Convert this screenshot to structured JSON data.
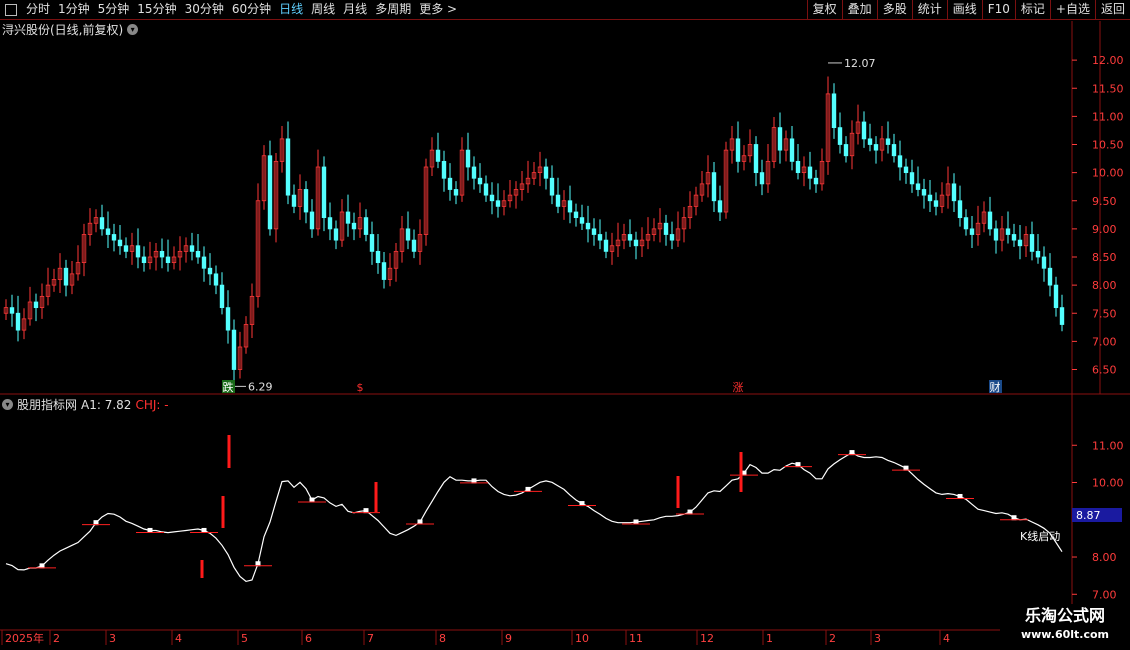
{
  "toolbar": {
    "periods": [
      "分时",
      "1分钟",
      "5分钟",
      "15分钟",
      "30分钟",
      "60分钟",
      "日线",
      "周线",
      "月线",
      "多周期",
      "更多 >"
    ],
    "active_period": "日线",
    "right_buttons": [
      "复权",
      "叠加",
      "多股",
      "统计",
      "画线",
      "F10",
      "标记",
      "+自选",
      "返回"
    ]
  },
  "main_chart": {
    "title": "浔兴股份(日线,前复权)",
    "high_label": "12.07",
    "low_label": "6.29",
    "y_ticks": [
      "12.00",
      "11.50",
      "11.00",
      "10.50",
      "10.00",
      "9.50",
      "9.00",
      "8.50",
      "8.00",
      "7.50",
      "7.00",
      "6.50"
    ],
    "markers": [
      {
        "text": "跌",
        "bg": "#1a6b1a",
        "color": "#ffffff"
      },
      {
        "text": "$",
        "bg": "#000000",
        "color": "#ff3030"
      },
      {
        "text": "涨",
        "bg": "#000000",
        "color": "#ff3030"
      },
      {
        "text": "财",
        "bg": "#1a4a8a",
        "color": "#ffffff"
      }
    ]
  },
  "indicator": {
    "name": "股朋指标网",
    "a1_text": "A1: 7.82",
    "chj_text": "CHJ: -",
    "y_ticks": [
      "11.00",
      "10.00",
      "8.00",
      "7.00"
    ],
    "current_value": "8.87",
    "annotation": "K线启动"
  },
  "date_axis": {
    "labels": [
      "2025年",
      "2",
      "3",
      "4",
      "5",
      "6",
      "7",
      "8",
      "9",
      "10",
      "11",
      "12",
      "1",
      "2",
      "3",
      "4"
    ]
  },
  "watermark": {
    "line1": "乐淘公式网",
    "line2": "www.60lt.com"
  },
  "chart_data": {
    "type": "candlestick",
    "title": "浔兴股份(日线,前复权)",
    "ylim": [
      6.1,
      12.5
    ],
    "price_series_close": [
      7.6,
      7.5,
      7.2,
      7.4,
      7.7,
      7.6,
      7.8,
      8.0,
      8.1,
      8.3,
      8.0,
      8.2,
      8.4,
      8.9,
      9.1,
      9.2,
      9.0,
      8.9,
      8.8,
      8.7,
      8.6,
      8.7,
      8.5,
      8.4,
      8.5,
      8.6,
      8.5,
      8.4,
      8.5,
      8.6,
      8.7,
      8.6,
      8.5,
      8.3,
      8.2,
      8.0,
      7.6,
      7.2,
      6.5,
      6.9,
      7.3,
      7.8,
      9.5,
      10.3,
      9.0,
      10.2,
      10.6,
      9.6,
      9.4,
      9.7,
      9.3,
      9.0,
      10.1,
      9.2,
      9.0,
      8.8,
      9.3,
      9.1,
      9.0,
      9.2,
      8.9,
      8.6,
      8.4,
      8.1,
      8.3,
      8.6,
      9.0,
      8.8,
      8.6,
      8.9,
      10.1,
      10.4,
      10.2,
      9.9,
      9.7,
      9.6,
      10.4,
      10.1,
      9.9,
      9.8,
      9.6,
      9.5,
      9.4,
      9.5,
      9.6,
      9.7,
      9.8,
      9.9,
      10.0,
      10.1,
      9.9,
      9.6,
      9.4,
      9.5,
      9.3,
      9.2,
      9.1,
      9.0,
      8.9,
      8.8,
      8.6,
      8.7,
      8.8,
      8.9,
      8.8,
      8.7,
      8.8,
      8.9,
      9.0,
      9.1,
      8.9,
      8.8,
      9.0,
      9.2,
      9.4,
      9.6,
      9.8,
      10.0,
      9.5,
      9.3,
      10.4,
      10.6,
      10.2,
      10.3,
      10.5,
      10.0,
      9.8,
      10.2,
      10.8,
      10.4,
      10.6,
      10.2,
      10.0,
      10.1,
      9.9,
      9.8,
      10.2,
      11.4,
      10.8,
      10.5,
      10.3,
      10.7,
      10.9,
      10.6,
      10.5,
      10.4,
      10.6,
      10.5,
      10.3,
      10.1,
      10.0,
      9.8,
      9.7,
      9.6,
      9.5,
      9.4,
      9.6,
      9.8,
      9.5,
      9.2,
      9.0,
      8.9,
      9.1,
      9.3,
      9.0,
      8.8,
      9.0,
      8.9,
      8.8,
      8.7,
      8.9,
      8.6,
      8.5,
      8.3,
      8.0,
      7.6,
      7.3
    ],
    "series": [
      {
        "name": "A1",
        "last_value": 7.82
      },
      {
        "name": "CHJ",
        "last_value": null
      }
    ]
  }
}
